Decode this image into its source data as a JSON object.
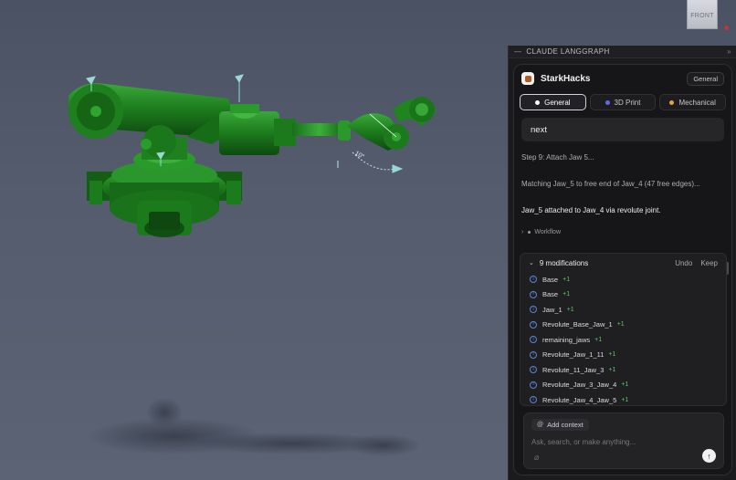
{
  "viewport": {
    "viewcube_label": "FRONT",
    "joint_angle_label": "10°"
  },
  "panel": {
    "header_title": "CLAUDE LANGGRAPH",
    "header_menu": "»"
  },
  "card": {
    "app_name": "StarkHacks",
    "mode_badge": "General",
    "tabs": [
      {
        "label": "General",
        "dot_color": "#ffffff",
        "active": true
      },
      {
        "label": "3D Print",
        "dot_color": "#5b6cf0",
        "active": false
      },
      {
        "label": "Mechanical",
        "dot_color": "#e9a23b",
        "active": false
      }
    ]
  },
  "chat": {
    "user_message": "next",
    "line1": "Step 9: Attach Jaw 5...",
    "line2": "Matching Jaw_5 to free end of Jaw_4 (47 free edges)...",
    "line3": "Jaw_5 attached to Jaw_4 via revolute joint.",
    "workflow_label": "Workflow"
  },
  "modifications": {
    "count_label": "9 modifications",
    "undo_label": "Undo",
    "keep_label": "Keep",
    "items": [
      {
        "name": "Base",
        "delta": "+1"
      },
      {
        "name": "Base",
        "delta": "+1"
      },
      {
        "name": "Jaw_1",
        "delta": "+1"
      },
      {
        "name": "Revolute_Base_Jaw_1",
        "delta": "+1"
      },
      {
        "name": "remaining_jaws",
        "delta": "+1"
      },
      {
        "name": "Revolute_Jaw_1_11",
        "delta": "+1"
      },
      {
        "name": "Revolute_11_Jaw_3",
        "delta": "+1"
      },
      {
        "name": "Revolute_Jaw_3_Jaw_4",
        "delta": "+1"
      },
      {
        "name": "Revolute_Jaw_4_Jaw_5",
        "delta": "+1"
      }
    ]
  },
  "composer": {
    "add_context_label": "Add context",
    "placeholder": "Ask, search, or make anything..."
  },
  "colors": {
    "model_green": "#1f8a1f",
    "accent_blue": "#5a86d8",
    "added_green": "#5cc46f"
  }
}
